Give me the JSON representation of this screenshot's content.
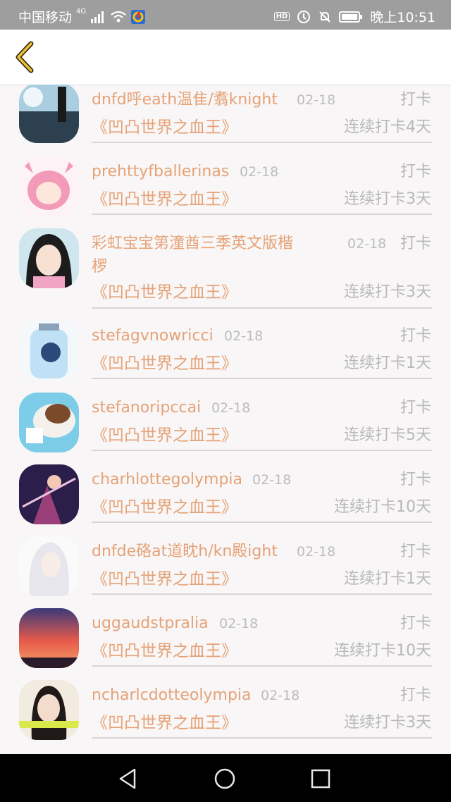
{
  "status_bar": {
    "carrier": "中国移动",
    "network": "4G",
    "hd_label": "HD",
    "time": "晚上10:51"
  },
  "toolbar": {
    "back_icon": "back-chevron-icon"
  },
  "colors": {
    "accent": "#e6a277",
    "muted": "#b8b8b8",
    "background": "#f8f6f6"
  },
  "checkins": [
    {
      "name": "dnfd呼eath温隹/翥knight",
      "date": "02-18",
      "action": "打卡",
      "book": "《凹凸世界之血王》",
      "streak": "连续打卡4天"
    },
    {
      "name": "prehttyfballerinas",
      "date": "02-18",
      "action": "打卡",
      "book": "《凹凸世界之血王》",
      "streak": "连续打卡3天"
    },
    {
      "name": "彩虹宝宝第潼酋三季英文版楷",
      "name_line2": "椤",
      "date": "02-18",
      "action": "打卡",
      "book": "《凹凸世界之血王》",
      "streak": "连续打卡3天"
    },
    {
      "name": "stefagvnowricci",
      "date": "02-18",
      "action": "打卡",
      "book": "《凹凸世界之血王》",
      "streak": "连续打卡1天"
    },
    {
      "name": "stefanoripccai",
      "date": "02-18",
      "action": "打卡",
      "book": "《凹凸世界之血王》",
      "streak": "连续打卡5天"
    },
    {
      "name": "charhlottegolympia",
      "date": "02-18",
      "action": "打卡",
      "book": "《凹凸世界之血王》",
      "streak": "连续打卡10天"
    },
    {
      "name": "dnfde硌at道眈h/kn殿ight",
      "date": "02-18",
      "action": "打卡",
      "book": "《凹凸世界之血王》",
      "streak": "连续打卡1天"
    },
    {
      "name": "uggaudstpralia",
      "date": "02-18",
      "action": "打卡",
      "book": "《凹凸世界之血王》",
      "streak": "连续打卡10天"
    },
    {
      "name": "ncharlcdotteolympia",
      "date": "02-18",
      "action": "打卡",
      "book": "《凹凸世界之血王》",
      "streak": "连续打卡3天"
    }
  ],
  "nav": {
    "back": "triangle-back-icon",
    "home": "circle-home-icon",
    "recents": "square-recents-icon"
  }
}
